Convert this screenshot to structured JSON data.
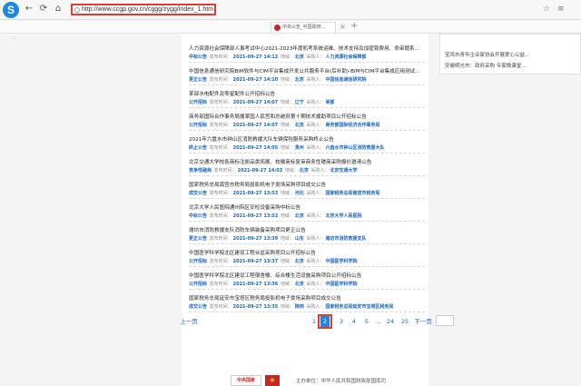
{
  "browser": {
    "url": "http://www.ccgp.gov.cn/cggg/zygg/index_1.htm",
    "tab_title": "中央公告_中国政府...",
    "back_icon": "←",
    "refresh_icon": "⟳",
    "home_icon": "⌂",
    "star_icon": "☆",
    "menu_icon": "≡"
  },
  "announcements": [
    {
      "title": "人力资源社会保障部人事考试中心2021-2023年度机考系统运维、技术支持及加密锁费用、命审题系...",
      "type": "中标公告",
      "date": "2021-09-27 14:12",
      "region": "北京",
      "buyer": "人力资源社会保障部"
    },
    {
      "title": "中国信息通信研究院BIM软件与CIM平台集成开发公共服务平台(后补助)-BIM与CIM平台集成应用测试...",
      "type": "更正公告",
      "date": "2021-09-27 14:10",
      "region": "北京",
      "buyer": "中国信息通信研究院"
    },
    {
      "title": "某部水电配件及零星配件公开招标公告",
      "type": "公开招标",
      "date": "2021-09-27 14:07",
      "region": "辽宁",
      "buyer": "某部"
    },
    {
      "title": "商务部国际合作事务局援某国人民宫和总统府第十期技术援助项目公开招标公告",
      "type": "公开招标",
      "date": "2021-09-27 14:07",
      "region": "北京",
      "buyer": "商务部国际经济合作事务局"
    },
    {
      "title": "2021年六盘水市钟山区消防救援大队车辆保险服务采购终止公告",
      "type": "终止公告",
      "date": "2021-09-27 14:05",
      "region": "贵州",
      "buyer": "六盘水市钟山区消防救援大队"
    },
    {
      "title": "北京交通大学校各商标注册品类拓展、校徽商标复审商务性磋商采购报价邀请公告",
      "type": "竞争性磋商",
      "date": "2021-09-27 14:03",
      "region": "北京",
      "buyer": "北京交通大学"
    },
    {
      "title": "国家税务总局南宫市税务局投影机电子类场采购项目成交公告",
      "type": "成交公告",
      "date": "2021-09-27 13:53",
      "region": "河北",
      "buyer": "国家税务总局南宫市税务局"
    },
    {
      "title": "北京大学人民医院通州院区安检设备采购中标公告",
      "type": "中标公告",
      "date": "2021-09-27 13:52",
      "region": "北京",
      "buyer": "北京大学人民医院"
    },
    {
      "title": "潍坊市消防救援支队消防车辆装备采购项目更正公告",
      "type": "更正公告",
      "date": "2021-09-27 13:39",
      "region": "山东",
      "buyer": "潍坊市消防救援支队"
    },
    {
      "title": "中国医学科学院北区建设工程台盆采购项目公开招标公告",
      "type": "公开招标",
      "date": "2021-09-27 13:37",
      "region": "北京",
      "buyer": "中国医学科学院"
    },
    {
      "title": "中国医学科学院北区建设工程宿舍楼、综合楼生活设施采购项目公开招标公告",
      "type": "公开招标",
      "date": "2021-09-27 13:36",
      "region": "北京",
      "buyer": "中国医学科学院"
    },
    {
      "title": "国家税务总局延安市宝塔区税务局投影机电子类场采购项目成交公告",
      "type": "成交公告",
      "date": "2021-09-27 13:35",
      "region": "陕西",
      "buyer": "国家税务总局延安市宝塔区税务局"
    }
  ],
  "labels": {
    "publish_time": "发布时间：",
    "region": "地域：",
    "buyer": "采购人："
  },
  "pagination": {
    "prev": "上一页",
    "pages": [
      "1",
      "2",
      "3",
      "4",
      "5",
      "...",
      "24",
      "25"
    ],
    "current": "2",
    "next": "下一页"
  },
  "right_panel": {
    "lines": [
      "宝鸡市青年企业家协会开展爱心公益...",
      "安徽明光市：政府采购 专家微课堂..."
    ]
  },
  "footer": {
    "logo1": "中央国家",
    "logo2": "★",
    "text": "主办单位：中华人民共和国财政部国库司"
  },
  "left_text": "..."
}
